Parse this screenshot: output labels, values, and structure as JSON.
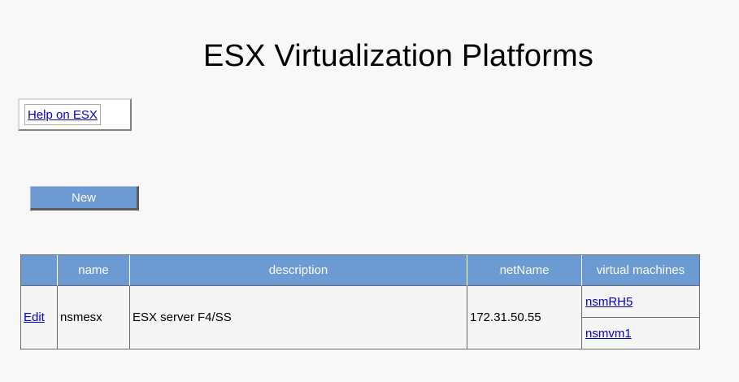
{
  "page": {
    "title": "ESX Virtualization Platforms"
  },
  "help": {
    "label": "Help on ESX"
  },
  "toolbar": {
    "new_label": "New"
  },
  "table": {
    "headers": {
      "edit": "",
      "name": "name",
      "description": "description",
      "netName": "netName",
      "virtual_machines": "virtual machines"
    },
    "rows": [
      {
        "edit_label": "Edit",
        "name": "nsmesx",
        "description": "ESX server F4/SS",
        "netName": "172.31.50.55",
        "virtual_machines": [
          "nsmRH5",
          "nsmvm1"
        ]
      }
    ]
  },
  "colors": {
    "header_bg": "#6c9ad3",
    "link": "#0000cc",
    "page_bg": "#f8f8f8"
  }
}
